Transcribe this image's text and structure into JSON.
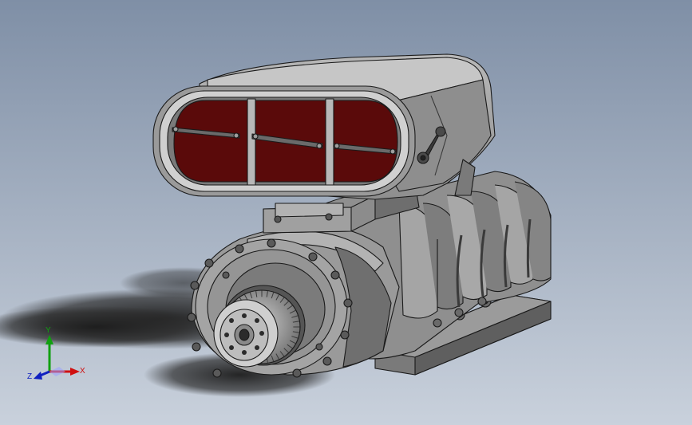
{
  "viewport": {
    "background_top": "#7f8fa6",
    "background_bottom": "#c9d1dc",
    "model_body_color": "#8a8a8a",
    "model_edge_color": "#1a1a1a",
    "scoop_screen_color": "#5a0a0a"
  },
  "triad": {
    "x_label": "X",
    "y_label": "Y",
    "z_label": "Z",
    "x_color": "#d01010",
    "y_color": "#10a010",
    "z_color": "#1020c0"
  }
}
